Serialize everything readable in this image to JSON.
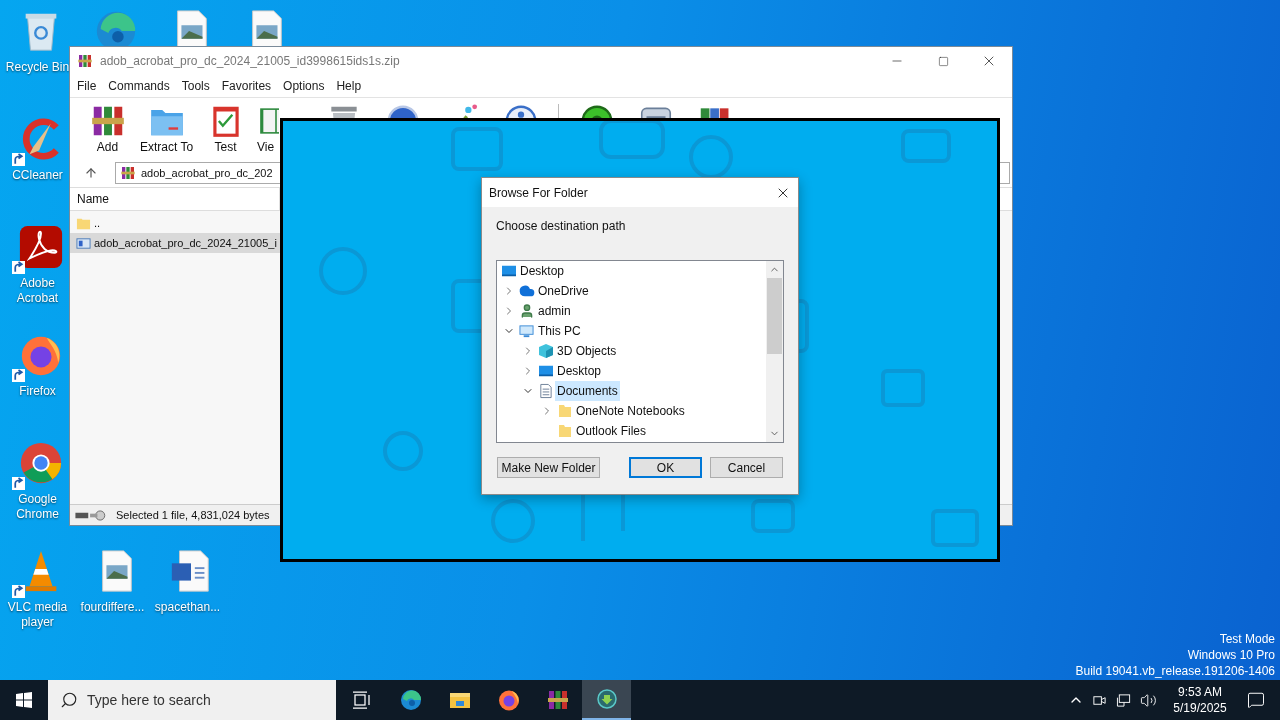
{
  "desktop": {
    "icons": [
      {
        "kind": "recycle-bin",
        "label": "Recycle Bin",
        "shortcut": false
      },
      {
        "kind": "edge",
        "shortcut": false
      },
      {
        "kind": "image-file",
        "shortcut": false
      },
      {
        "kind": "image-file",
        "shortcut": false
      },
      {
        "kind": "ccleaner",
        "label": "CCleaner",
        "shortcut": true
      },
      {
        "kind": "acrobat",
        "label": "Adobe Acrobat",
        "shortcut": true
      },
      {
        "kind": "firefox",
        "label": "Firefox",
        "shortcut": true
      },
      {
        "kind": "chrome",
        "label": "Google Chrome",
        "shortcut": true
      },
      {
        "kind": "vlc",
        "label": "VLC media player",
        "shortcut": true
      },
      {
        "kind": "image-file",
        "label": "fourdiffere...",
        "shortcut": false
      },
      {
        "kind": "word-file",
        "label": "spacethan...",
        "shortcut": false
      }
    ],
    "system_notice": [
      "Test Mode",
      "Windows 10 Pro",
      "Build 19041.vb_release.191206-1406"
    ]
  },
  "archive_window": {
    "title": "adob_acrobat_pro_dc_2024_21005_id3998615ids1s.zip",
    "menu": [
      "File",
      "Commands",
      "Tools",
      "Favorites",
      "Options",
      "Help"
    ],
    "toolbar": [
      {
        "kind": "add",
        "label": "Add"
      },
      {
        "kind": "extract",
        "label": "Extract To"
      },
      {
        "kind": "test",
        "label": "Test"
      },
      {
        "kind": "view",
        "label": "Vie"
      },
      {
        "kind": "delete"
      },
      {
        "kind": "find"
      },
      {
        "kind": "wizard"
      },
      {
        "kind": "info"
      },
      {
        "kind": "separator"
      },
      {
        "kind": "virus-scan"
      },
      {
        "kind": "sfx"
      },
      {
        "kind": "archive"
      }
    ],
    "address": "adob_acrobat_pro_dc_202",
    "columns": [
      "Name"
    ],
    "rows": [
      {
        "kind": "folder",
        "name": "..",
        "selected": false
      },
      {
        "kind": "file",
        "name": "adob_acrobat_pro_dc_2024_21005_i",
        "selected": true
      }
    ],
    "status": "Selected 1 file, 4,831,024 bytes"
  },
  "dialog": {
    "title": "Browse For Folder",
    "prompt": "Choose destination path",
    "tree": [
      {
        "label": "Desktop",
        "kind": "desktop",
        "expander": false,
        "selected": false,
        "children": [
          {
            "label": "OneDrive",
            "kind": "cloud",
            "expander": true,
            "expanded": false,
            "selected": false
          },
          {
            "label": "admin",
            "kind": "user",
            "expander": true,
            "expanded": false,
            "selected": false
          },
          {
            "label": "This PC",
            "kind": "computer",
            "expander": true,
            "expanded": true,
            "selected": false,
            "children": [
              {
                "label": "3D Objects",
                "kind": "cube",
                "expander": true,
                "expanded": false,
                "selected": false
              },
              {
                "label": "Desktop",
                "kind": "desktop",
                "expander": true,
                "expanded": false,
                "selected": false
              },
              {
                "label": "Documents",
                "kind": "documents",
                "expander": true,
                "expanded": true,
                "selected": true,
                "children": [
                  {
                    "label": "OneNote Notebooks",
                    "kind": "folder",
                    "expander": true,
                    "expanded": false,
                    "selected": false
                  },
                  {
                    "label": "Outlook Files",
                    "kind": "folder",
                    "expander": false,
                    "selected": false
                  }
                ]
              }
            ]
          }
        ]
      }
    ],
    "buttons": [
      {
        "label": "Make New Folder",
        "default": false
      },
      {
        "label": "OK",
        "default": true
      },
      {
        "label": "Cancel",
        "default": false
      }
    ]
  },
  "taskbar": {
    "search": {
      "placeholder": "Type here to search"
    },
    "apps": [
      {
        "kind": "task-view",
        "active": false
      },
      {
        "kind": "edge",
        "active": false
      },
      {
        "kind": "explorer",
        "active": false
      },
      {
        "kind": "firefox",
        "active": false
      },
      {
        "kind": "winrar",
        "active": false
      },
      {
        "kind": "installer",
        "active": true
      }
    ],
    "clock": {
      "time": "9:53 AM",
      "date": "5/19/2025"
    }
  }
}
